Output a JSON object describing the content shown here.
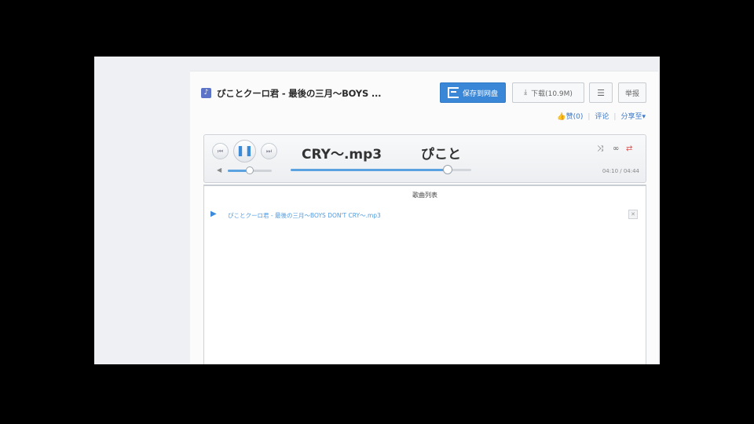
{
  "header": {
    "file_icon": "music-file-icon",
    "title": "ぴことクーロ君 - 最後の三月〜BOYS ...",
    "save_button": "保存到网盘",
    "download_button": "下载(10.9M)",
    "more_button": "☰",
    "report_button": "举报",
    "like_link": "👍赞(0)",
    "comment_link": "评论",
    "share_link": "分享至▾"
  },
  "player": {
    "song_name": "CRY～.mp3",
    "artist": "ぴこと",
    "prev_icon": "⏮",
    "play_pause_icon": "❚❚",
    "next_icon": "⏭",
    "volume_icon": "◀",
    "volume_level": 0.5,
    "progress_level": 0.87,
    "shuffle_icon": "⤨",
    "loop_icon": "∞",
    "repeat_icon": "⇄",
    "time": "04:10 / 04:44"
  },
  "playlist": {
    "title": "歌曲列表",
    "items": [
      {
        "name": "ぴことクーロ君 - 最後の三月〜BOYS DON'T CRY〜.mp3",
        "icon": "▶",
        "delete": "✕"
      }
    ]
  },
  "colors": {
    "accent": "#3a87d8",
    "repeat_active": "#e05555"
  }
}
